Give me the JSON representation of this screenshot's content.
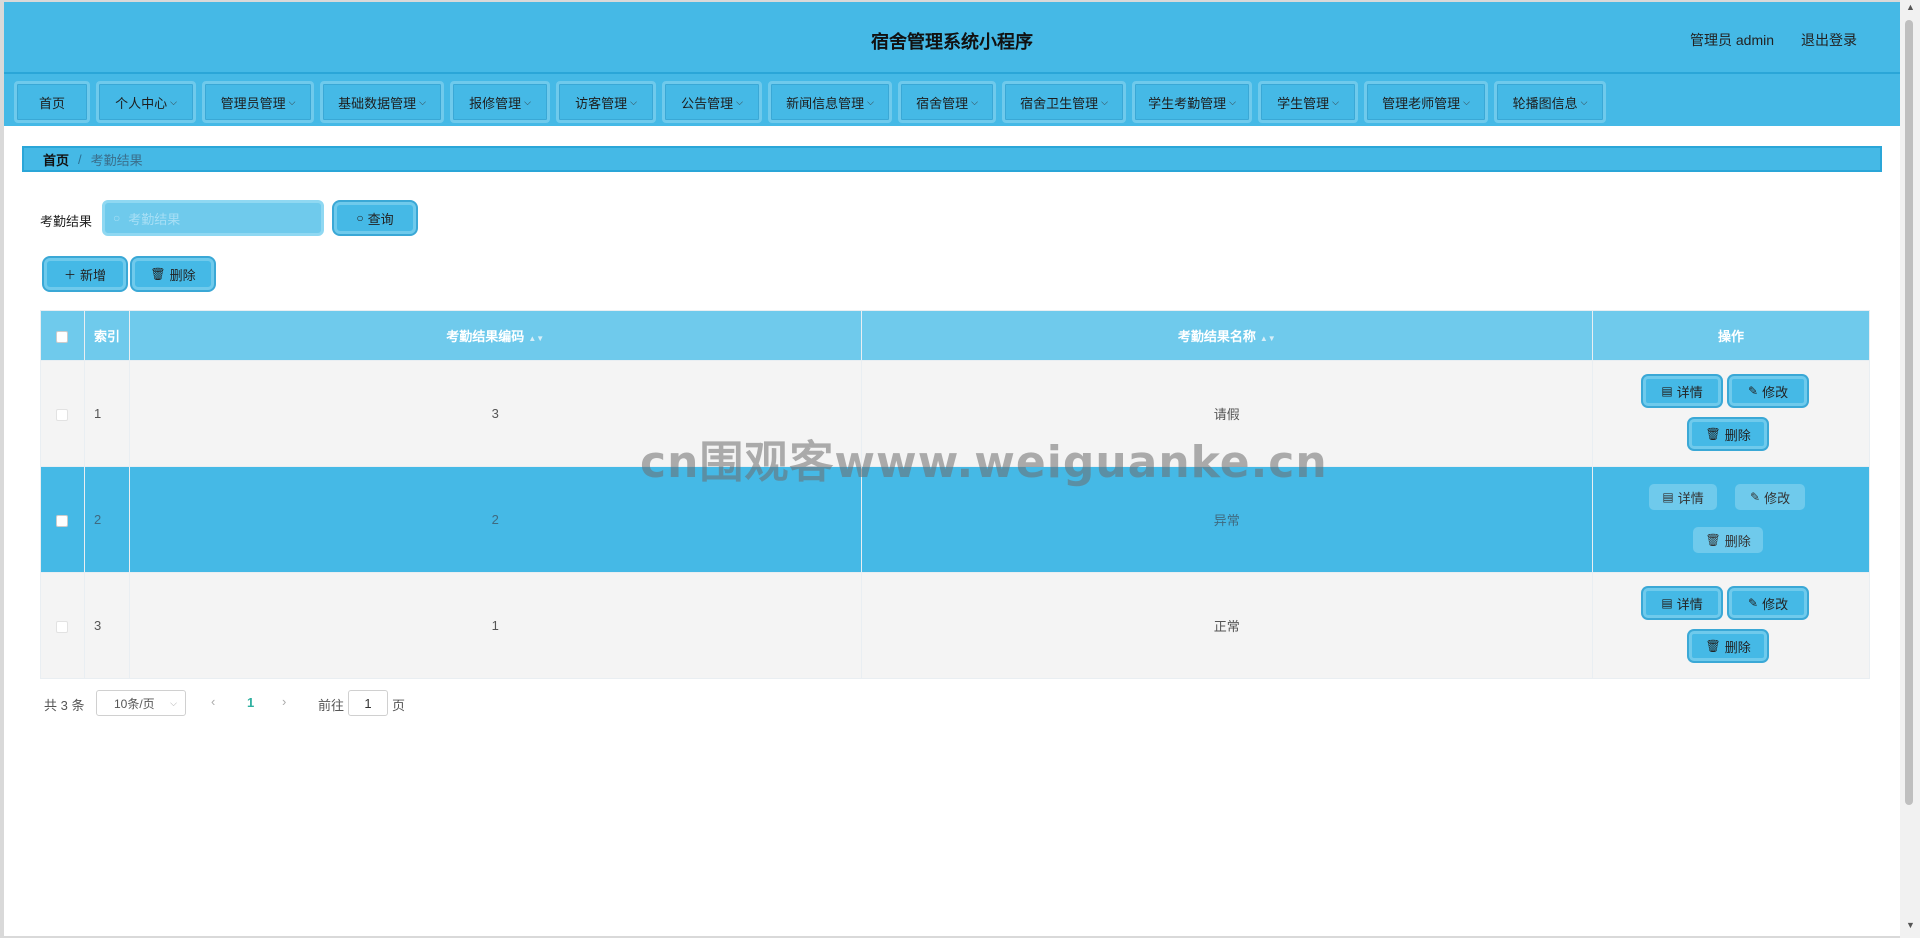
{
  "header": {
    "title": "宿舍管理系统小程序",
    "user": "管理员 admin",
    "logout": "退出登录"
  },
  "nav": {
    "items": [
      {
        "label": "首页",
        "dropdown": false
      },
      {
        "label": "个人中心",
        "dropdown": true
      },
      {
        "label": "管理员管理",
        "dropdown": true
      },
      {
        "label": "基础数据管理",
        "dropdown": true
      },
      {
        "label": "报修管理",
        "dropdown": true
      },
      {
        "label": "访客管理",
        "dropdown": true
      },
      {
        "label": "公告管理",
        "dropdown": true
      },
      {
        "label": "新闻信息管理",
        "dropdown": true
      },
      {
        "label": "宿舍管理",
        "dropdown": true
      },
      {
        "label": "宿舍卫生管理",
        "dropdown": true
      },
      {
        "label": "学生考勤管理",
        "dropdown": true
      },
      {
        "label": "学生管理",
        "dropdown": true
      },
      {
        "label": "管理老师管理",
        "dropdown": true
      },
      {
        "label": "轮播图信息",
        "dropdown": true
      }
    ]
  },
  "breadcrumb": {
    "home": "首页",
    "separator": "/",
    "current": "考勤结果"
  },
  "search": {
    "label": "考勤结果",
    "placeholder": "考勤结果",
    "button": "查询"
  },
  "actions": {
    "add": "新增",
    "delete": "删除"
  },
  "table": {
    "headers": {
      "index": "索引",
      "code": "考勤结果编码",
      "name": "考勤结果名称",
      "ops": "操作"
    },
    "rows": [
      {
        "index": "1",
        "code": "3",
        "name": "请假"
      },
      {
        "index": "2",
        "code": "2",
        "name": "异常"
      },
      {
        "index": "3",
        "code": "1",
        "name": "正常"
      }
    ],
    "row_buttons": {
      "detail": "详情",
      "edit": "修改",
      "delete": "删除"
    }
  },
  "pagination": {
    "total": "共 3 条",
    "page_size": "10条/页",
    "current_page": "1",
    "goto_prefix": "前往",
    "goto_value": "1",
    "goto_suffix": "页"
  },
  "watermark": "cn围观客www.weiguanke.cn",
  "colors": {
    "primary": "#45b9e6",
    "light": "#6fcaec",
    "header_row": "#6fcaec",
    "highlight_row": "#45b9e6"
  }
}
